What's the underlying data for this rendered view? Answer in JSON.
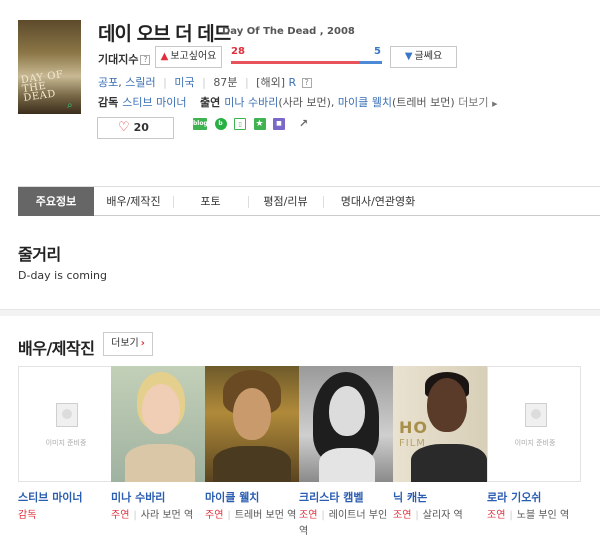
{
  "movie": {
    "title_ko": "데이 오브 더 데드",
    "title_en": "Day Of The Dead , 2008",
    "poster": {
      "title_text": "DAY OF THE DEAD",
      "zoom_icon": "search-icon"
    }
  },
  "expect": {
    "label": "기대지수",
    "help_icon": "question-icon",
    "want_label": "보고싶어요",
    "want_icon": "thumbs-up-icon",
    "want_count": "28",
    "no_label": "글쎄요",
    "no_icon": "thumbs-down-icon",
    "no_count": "5",
    "want_ratio": 0.85,
    "want_color": "#e8525b",
    "no_color": "#4d8ad6"
  },
  "meta": {
    "genre1": "공포",
    "genre_sep": ",",
    "genre2": "스릴러",
    "country": "미국",
    "runtime": "87분",
    "rating_prefix": "[해외]",
    "rating": "R"
  },
  "staff": {
    "director_label": "감독",
    "director": "스티브 마이너",
    "cast_label": "출연",
    "actor1": "미나 수바리",
    "actor1_role": "(사라 보먼)",
    "actor2": "마이클 웰치",
    "actor2_role": "(트레버 보먼)",
    "more": "더보기"
  },
  "like": {
    "icon": "heart-icon",
    "count": "20"
  },
  "share": {
    "blog": "blog",
    "band": "band-icon",
    "kakao": "kakao-icon",
    "star": "star-icon",
    "facebook": "facebook-icon",
    "export": "share-export-icon"
  },
  "tabs": [
    "주요정보",
    "배우/제작진",
    "포토",
    "평점/리뷰",
    "명대사/연관영화"
  ],
  "synopsis": {
    "title": "줄거리",
    "text": "D-day is coming"
  },
  "cast_section": {
    "title": "배우/제작진",
    "more_label": "더보기",
    "placeholder_text": "이미지 준비중",
    "items": [
      {
        "name": "스티브 마이너",
        "type": "감독",
        "role": ""
      },
      {
        "name": "미나 수바리",
        "type": "주연",
        "role": "사라 보먼 역"
      },
      {
        "name": "마이클 웰치",
        "type": "주연",
        "role": "트레버 보먼 역"
      },
      {
        "name": "크리스타 캠벨",
        "type": "조연",
        "role": "레이트너 부인 역"
      },
      {
        "name": "닉 캐논",
        "type": "조연",
        "role": "살리자 역"
      },
      {
        "name": "로라 기오쉬",
        "type": "조연",
        "role": "노블 부인 역"
      }
    ]
  }
}
